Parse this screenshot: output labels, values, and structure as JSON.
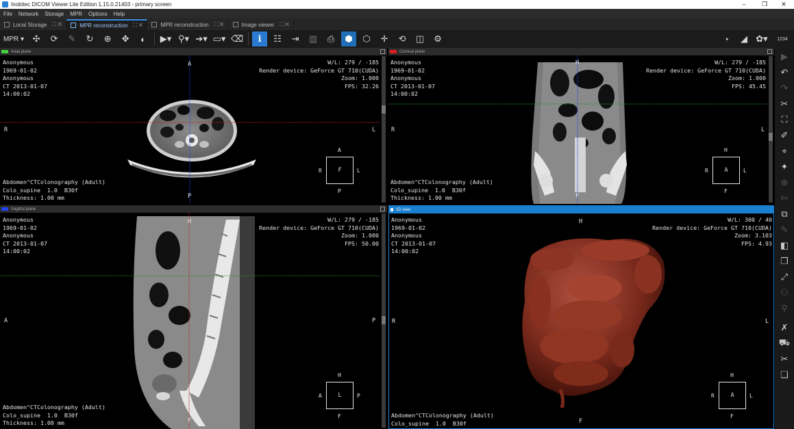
{
  "window": {
    "title": "Inobitec DICOM Viewer Lite Edition 1.15.0.21403 - primary screen",
    "min": "–",
    "max": "❐",
    "close": "✕"
  },
  "menu": [
    "File",
    "Network",
    "Storage",
    "MPR",
    "Options",
    "Help"
  ],
  "tabs": [
    {
      "label": "Local Storage",
      "active": false
    },
    {
      "label": "MPR reconstruction",
      "active": true
    },
    {
      "label": "MPR reconstruction",
      "active": false
    },
    {
      "label": "Image viewer",
      "active": false
    }
  ],
  "toolbar": {
    "mpr_label": "MPR",
    "badge": "1234"
  },
  "viewports": {
    "axial": {
      "title": "Axial plane",
      "color": "#3fd13f",
      "top_left": "Anonymous\n1969-01-02\nAnonymous\nCT 2013-01-07\n14:00:02",
      "top_right": "W/L: 279 / -185\nRender device: GeForce GT 710(CUDA)\nZoom: 1.000\nFPS: 32.26",
      "bottom_left": "Abdomen^CTColonography (Adult)\nColo_supine  1.0  B30f\nThickness: 1.00 mm",
      "ori": {
        "top": "A",
        "bottom": "P",
        "left": "R",
        "right": "L"
      },
      "cube": {
        "center": "F",
        "top": "A",
        "bottom": "P",
        "left": "R",
        "right": "L"
      }
    },
    "coronal": {
      "title": "Coronal plane",
      "color": "#e02020",
      "top_left": "Anonymous\n1969-01-02\nAnonymous\nCT 2013-01-07\n14:00:02",
      "top_right": "W/L: 279 / -185\nRender device: GeForce GT 710(CUDA)\nZoom: 1.000\nFPS: 45.45",
      "bottom_left": "Abdomen^CTColonography (Adult)\nColo_supine  1.0  B30f\nThickness: 1.00 mm",
      "ori": {
        "top": "H",
        "bottom": "F",
        "left": "R",
        "right": "L"
      },
      "cube": {
        "center": "A",
        "top": "H",
        "bottom": "F",
        "left": "R",
        "right": "L"
      }
    },
    "sagittal": {
      "title": "Sagittal plane",
      "color": "#2244ee",
      "top_left": "Anonymous\n1969-01-02\nAnonymous\nCT 2013-01-07\n14:00:02",
      "top_right": "W/L: 279 / -185\nRender device: GeForce GT 710(CUDA)\nZoom: 1.000\nFPS: 50.00",
      "bottom_left": "Abdomen^CTColonography (Adult)\nColo_supine  1.0  B30f\nThickness: 1.00 mm",
      "ori": {
        "top": "H",
        "bottom": "F",
        "left": "A",
        "right": "P"
      },
      "cube": {
        "center": "L",
        "top": "H",
        "bottom": "F",
        "left": "A",
        "right": "P"
      }
    },
    "view3d": {
      "title": "3D view",
      "color": "#1a7fcf",
      "top_left": "Anonymous\n1969-01-02\nAnonymous\nCT 2013-01-07\n14:00:02",
      "top_right": "W/L: 300 / 40\nRender device: GeForce GT 710(CUDA)\nZoom: 3.103\nFPS: 4.93",
      "bottom_left": "Abdomen^CTColonography (Adult)\nColo_supine  1.0  B30f",
      "ori": {
        "top": "H",
        "bottom": "F",
        "left": "R",
        "right": "L"
      },
      "cube": {
        "center": "A",
        "top": "H",
        "bottom": "F",
        "left": "R",
        "right": "L"
      }
    }
  }
}
